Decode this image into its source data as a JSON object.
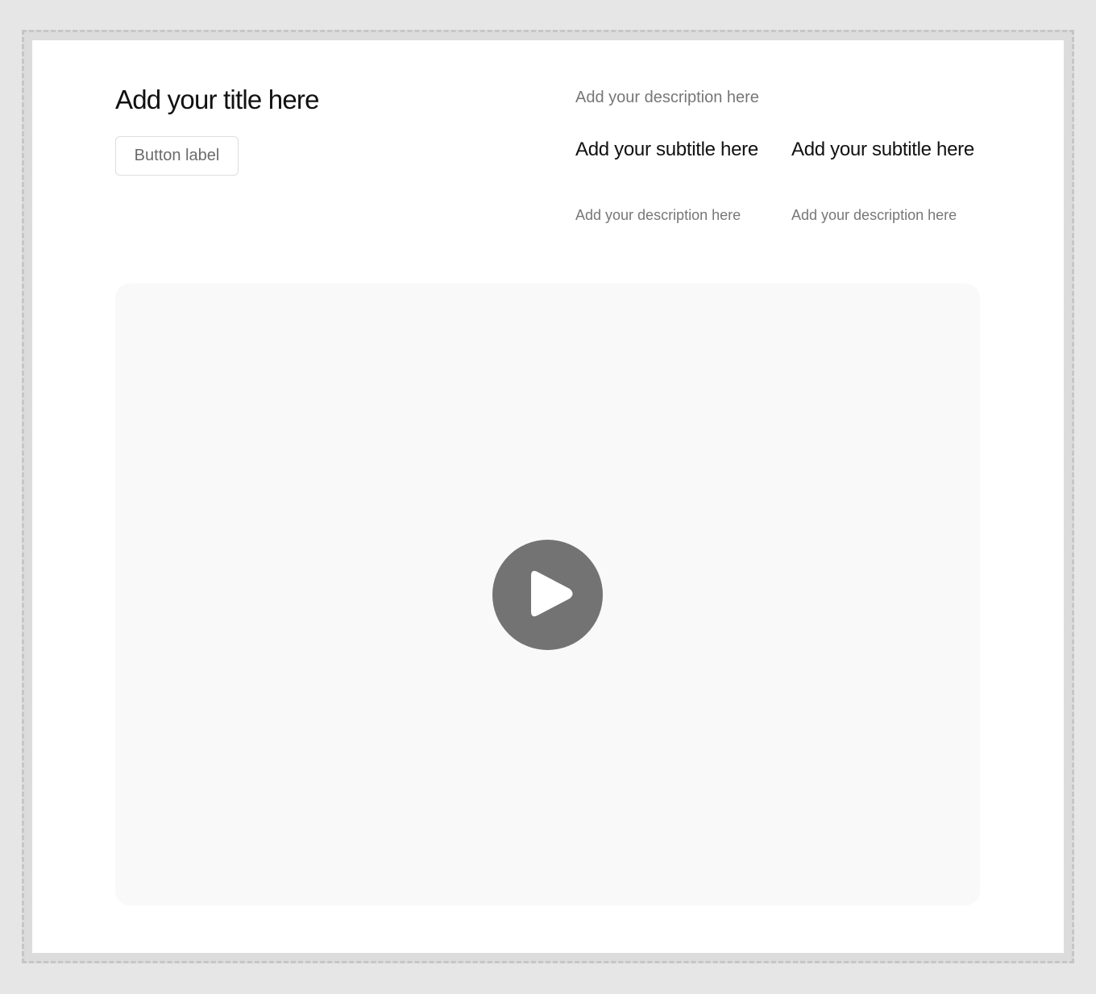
{
  "header": {
    "title": "Add your title here",
    "button_label": "Button label",
    "description": "Add your description here"
  },
  "features": [
    {
      "subtitle": "Add your subtitle here",
      "description": "Add your description here"
    },
    {
      "subtitle": "Add your subtitle here",
      "description": "Add your description here"
    }
  ],
  "video": {
    "play_icon": "play-icon"
  },
  "colors": {
    "page_bg": "#e6e6e6",
    "card_bg": "#ffffff",
    "video_bg": "#f9f9f9",
    "play_button": "#737373",
    "heading_text": "#111111",
    "muted_text": "#777777"
  }
}
